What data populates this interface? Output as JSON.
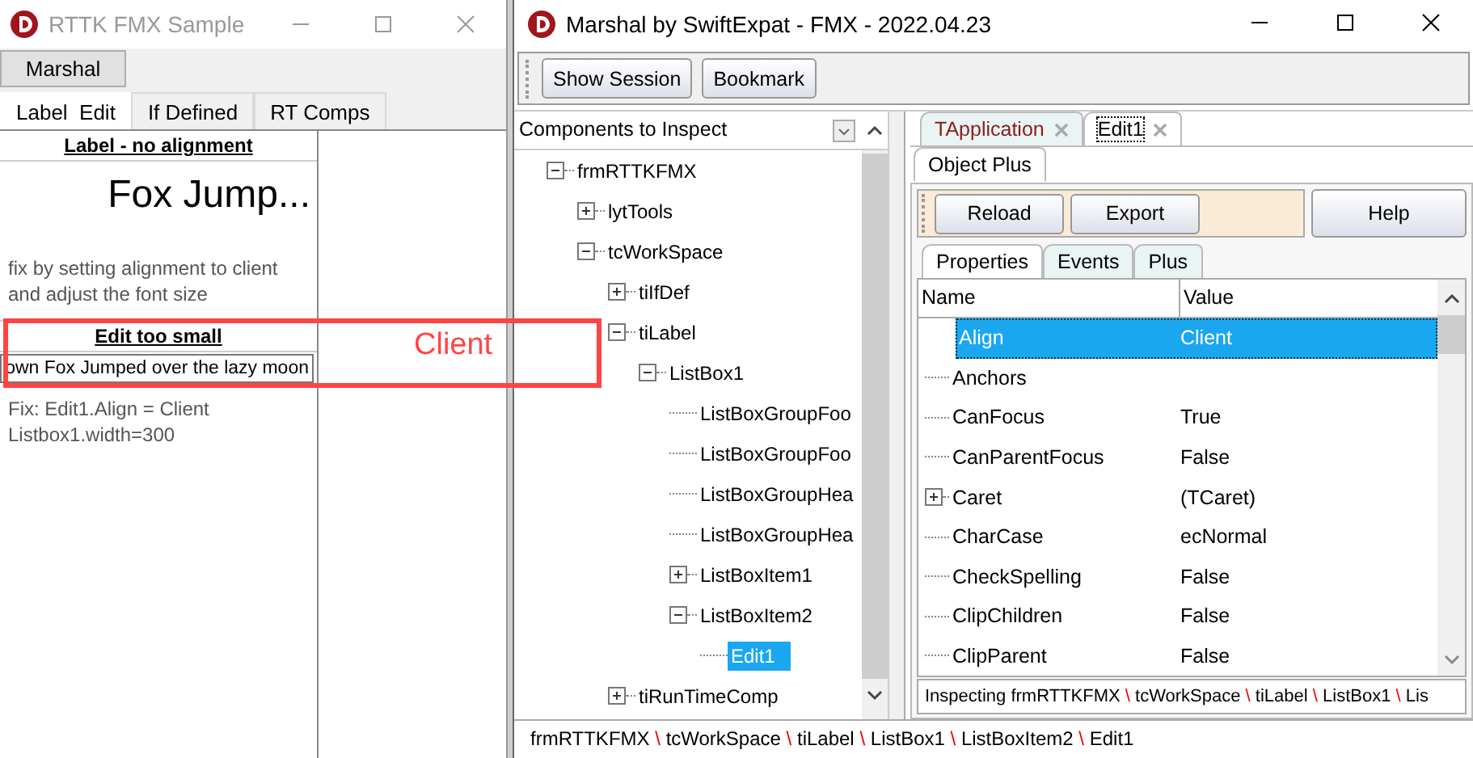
{
  "left_window": {
    "title": "RTTK FMX Sample",
    "toolbar_button": "Marshal",
    "tabs": [
      {
        "label": "Label  Edit",
        "selected": true
      },
      {
        "label": "If Defined",
        "selected": false
      },
      {
        "label": "RT Comps",
        "selected": false
      }
    ],
    "panel": {
      "label_heading": "Label - no alignment",
      "big_label": "Fox Jump...",
      "hint_lines": [
        "fix by setting alignment to client",
        "and adjust the font size"
      ],
      "edit_heading": "Edit too small",
      "edit_value": "own Fox Jumped over the lazy moon",
      "fix_lines": [
        "Fix: Edit1.Align = Client",
        "Listbox1.width=300"
      ]
    }
  },
  "annotation": {
    "label": "Client"
  },
  "marshal_window": {
    "title": "Marshal by SwiftExpat - FMX - 2022.04.23",
    "toolbar": [
      "Show Session",
      "Bookmark"
    ],
    "combo": {
      "value": "Components to Inspect"
    },
    "tree": [
      {
        "label": "frmRTTKFMX",
        "expanded": true,
        "selected": false,
        "children": [
          {
            "label": "lytTools",
            "expanded": false,
            "selected": false
          },
          {
            "label": "tcWorkSpace",
            "expanded": true,
            "selected": false,
            "children": [
              {
                "label": "tiIfDef",
                "expanded": false,
                "selected": false
              },
              {
                "label": "tiLabel",
                "expanded": true,
                "selected": false,
                "children": [
                  {
                    "label": "ListBox1",
                    "expanded": true,
                    "selected": false,
                    "children": [
                      {
                        "label": "ListBoxGroupFoo",
                        "selected": false
                      },
                      {
                        "label": "ListBoxGroupFoo",
                        "selected": false
                      },
                      {
                        "label": "ListBoxGroupHea",
                        "selected": false
                      },
                      {
                        "label": "ListBoxGroupHea",
                        "selected": false
                      },
                      {
                        "label": "ListBoxItem1",
                        "expanded": false,
                        "selected": false
                      },
                      {
                        "label": "ListBoxItem2",
                        "expanded": true,
                        "selected": false,
                        "children": [
                          {
                            "label": "Edit1",
                            "selected": true
                          }
                        ]
                      }
                    ]
                  }
                ]
              },
              {
                "label": "tiRunTimeComp",
                "expanded": false,
                "selected": false
              }
            ]
          }
        ]
      }
    ],
    "doc_tabs": [
      {
        "label": "TApplication",
        "kind": "application",
        "selected": false
      },
      {
        "label": "Edit1",
        "kind": "component",
        "selected": true
      }
    ],
    "inspector_tabs": [
      {
        "label": "Object Plus",
        "selected": true
      }
    ],
    "actions": [
      "Reload",
      "Export"
    ],
    "help": "Help",
    "property_tabs": [
      {
        "label": "Properties",
        "selected": true
      },
      {
        "label": "Events",
        "selected": false
      },
      {
        "label": "Plus",
        "selected": false
      }
    ],
    "grid": {
      "columns": [
        "Name",
        "Value"
      ],
      "rows": [
        {
          "name": "Align",
          "value": "Client",
          "selected": true
        },
        {
          "name": "Anchors",
          "selected": false
        },
        {
          "name": "CanFocus",
          "value": "True",
          "selected": false
        },
        {
          "name": "CanParentFocus",
          "value": "False",
          "selected": false
        },
        {
          "name": "Caret",
          "value": "(TCaret)",
          "expanded": false,
          "selected": false
        },
        {
          "name": "CharCase",
          "value": "ecNormal",
          "selected": false
        },
        {
          "name": "CheckSpelling",
          "value": "False",
          "selected": false
        },
        {
          "name": "ClipChildren",
          "value": "False",
          "selected": false
        },
        {
          "name": "ClipParent",
          "value": "False",
          "selected": false
        }
      ]
    },
    "inspecting": {
      "prefix": "Inspecting",
      "separator": "\\",
      "segments": [
        "frmRTTKFMX",
        "tcWorkSpace",
        "tiLabel",
        "ListBox1",
        "Lis"
      ]
    },
    "status_bar": {
      "separator": "\\",
      "segments": [
        "frmRTTKFMX",
        "tcWorkSpace",
        "tiLabel",
        "ListBox1",
        "ListBoxItem2",
        "Edit1"
      ]
    }
  }
}
